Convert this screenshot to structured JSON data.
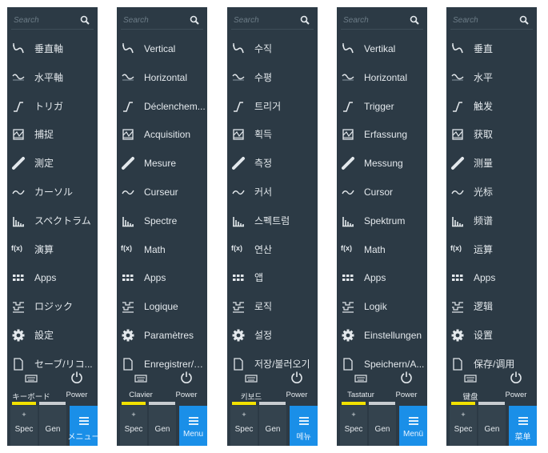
{
  "colors": {
    "panel_bg": "#2c3a45",
    "text": "#e3e8ec",
    "muted": "#6c7c87",
    "menu_accent": "#1a8fe8",
    "indicator_active": "#f2e100",
    "indicator_inactive": "#c8ccd0"
  },
  "icons": [
    "vertical-icon",
    "horizontal-icon",
    "trigger-icon",
    "acquisition-icon",
    "measure-icon",
    "cursor-icon",
    "spectrum-icon",
    "math-icon",
    "apps-icon",
    "logic-icon",
    "settings-icon",
    "save-recall-icon"
  ],
  "math_icon_text": "f(x)",
  "panels": [
    {
      "search_placeholder": "Search",
      "items": [
        "垂直軸",
        "水平軸",
        "トリガ",
        "捕捉",
        "測定",
        "カーソル",
        "スペクトラム",
        "演算",
        "Apps",
        "ロジック",
        "設定",
        "セーブ/リコ..."
      ],
      "keyboard_label": "キーボード",
      "power_label": "Power",
      "spec_plus": "+",
      "spec_label": "Spec",
      "gen_label": "Gen",
      "menu_label": "メニュー"
    },
    {
      "search_placeholder": "Search",
      "items": [
        "Vertical",
        "Horizontal",
        "Déclenchem...",
        "Acquisition",
        "Mesure",
        "Curseur",
        "Spectre",
        "Math",
        "Apps",
        "Logique",
        "Paramètres",
        "Enregistrer/c..."
      ],
      "keyboard_label": "Clavier",
      "power_label": "Power",
      "spec_plus": "+",
      "spec_label": "Spec",
      "gen_label": "Gen",
      "menu_label": "Menu"
    },
    {
      "search_placeholder": "Search",
      "items": [
        "수직",
        "수평",
        "트리거",
        "획득",
        "측정",
        "커서",
        "스펙트럼",
        "연산",
        "앱",
        "로직",
        "설정",
        "저장/불러오기"
      ],
      "keyboard_label": "키보드",
      "power_label": "Power",
      "spec_plus": "+",
      "spec_label": "Spec",
      "gen_label": "Gen",
      "menu_label": "메뉴"
    },
    {
      "search_placeholder": "Search",
      "items": [
        "Vertikal",
        "Horizontal",
        "Trigger",
        "Erfassung",
        "Messung",
        "Cursor",
        "Spektrum",
        "Math",
        "Apps",
        "Logik",
        "Einstellungen",
        "Speichern/A..."
      ],
      "keyboard_label": "Tastatur",
      "power_label": "Power",
      "spec_plus": "+",
      "spec_label": "Spec",
      "gen_label": "Gen",
      "menu_label": "Menü"
    },
    {
      "search_placeholder": "Search",
      "items": [
        "垂直",
        "水平",
        "触发",
        "获取",
        "测量",
        "光标",
        "频谱",
        "运算",
        "Apps",
        "逻辑",
        "设置",
        "保存/调用"
      ],
      "keyboard_label": "键盘",
      "power_label": "Power",
      "spec_plus": "+",
      "spec_label": "Spec",
      "gen_label": "Gen",
      "menu_label": "菜单"
    }
  ]
}
